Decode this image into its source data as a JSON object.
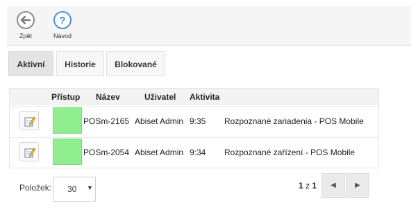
{
  "toolbar": {
    "back_label": "Zpět",
    "help_label": "Návod",
    "back_icon": "arrow-left-circle-icon",
    "help_icon": "question-circle-icon",
    "icon_color": "#8a8a8a",
    "help_color": "#4a90d9"
  },
  "tabs": [
    {
      "label": "Aktivní",
      "active": true
    },
    {
      "label": "Historie",
      "active": false
    },
    {
      "label": "Blokované",
      "active": false
    }
  ],
  "table": {
    "columns": [
      "Přístup",
      "Název",
      "Uživatel",
      "Aktivita"
    ],
    "rows": [
      {
        "color": "#90ee90",
        "name": "POSm-2165",
        "user": "Abiset Admin",
        "time": "9:35",
        "activity": "Rozpoznané zariadenia - POS Mobile"
      },
      {
        "color": "#90ee90",
        "name": "POSm-2054",
        "user": "Abiset Admin",
        "time": "9:34",
        "activity": "Rozpoznané zařízení - POS Mobile"
      }
    ]
  },
  "pagination": {
    "items_label": "Položek:",
    "page_size": "30",
    "current": "1",
    "separator": "z",
    "total": "1",
    "prev_icon": "caret-left-icon",
    "next_icon": "caret-right-icon"
  }
}
